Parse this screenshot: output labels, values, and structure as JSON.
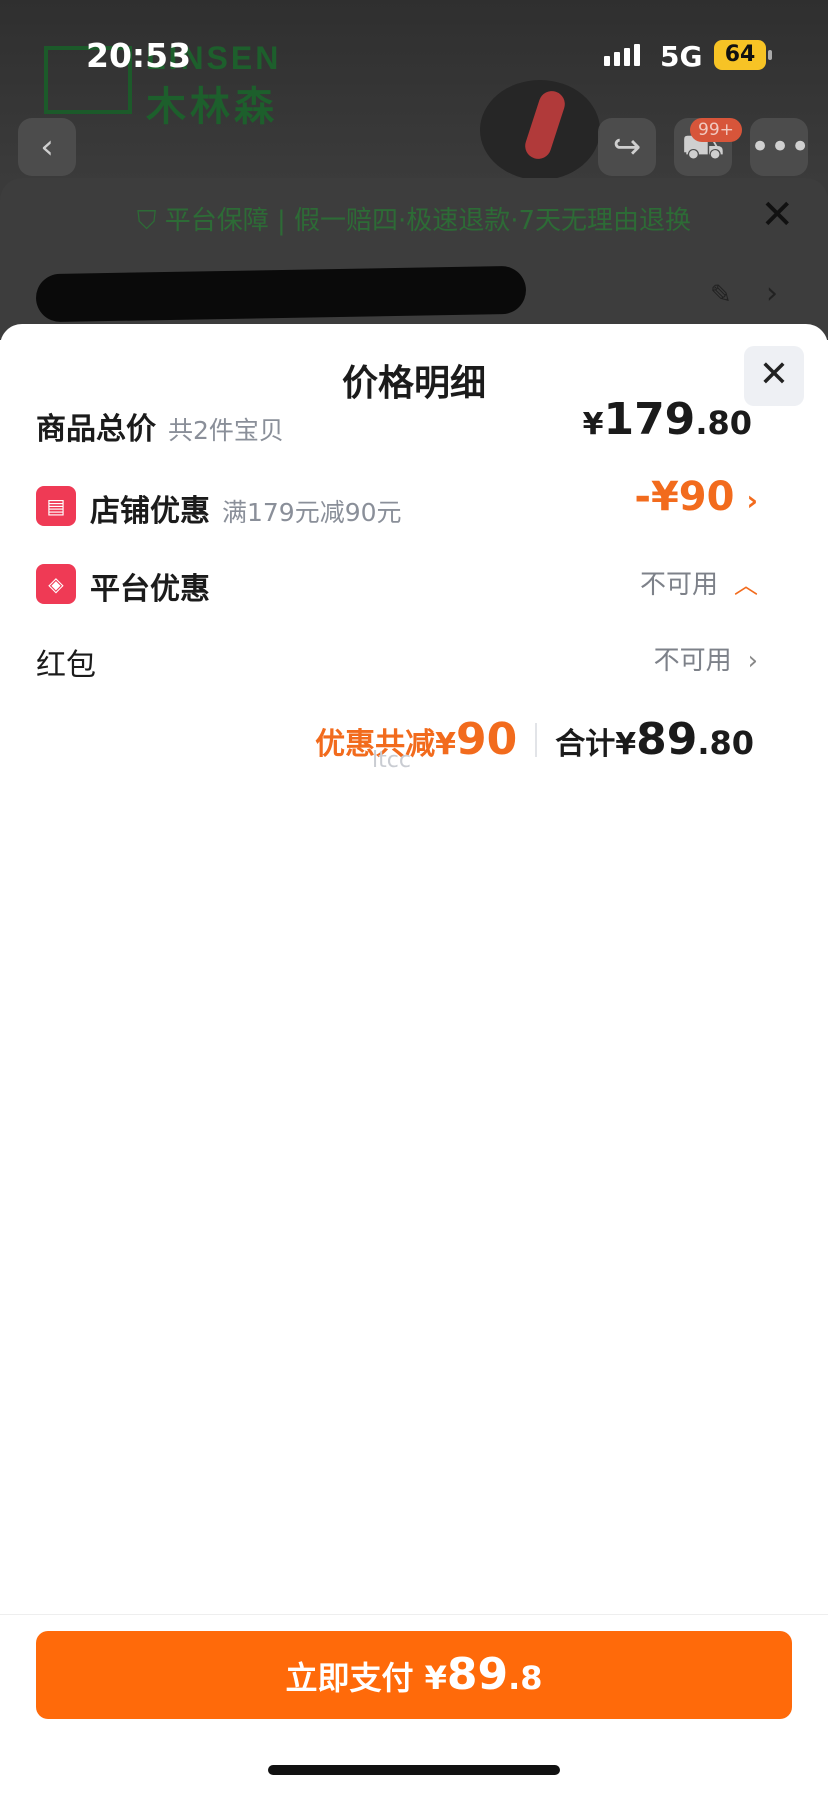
{
  "status_bar": {
    "time": "20:53",
    "network": "5G",
    "battery": "64"
  },
  "brand": {
    "name_en": "LINSEN",
    "name_cn": "木林森"
  },
  "cart_badge": "99+",
  "guarantee": {
    "text": "平台保障 | 假一赔四·极速退款·7天无理由退换"
  },
  "sheet": {
    "title": "价格明细",
    "rows": {
      "total": {
        "label": "商品总价",
        "sub": "共2件宝贝",
        "yen": "¥",
        "int": "179",
        "dec": ".80"
      },
      "shop": {
        "label": "店铺优惠",
        "sub": "满179元减90元",
        "value": "-¥90"
      },
      "platform": {
        "label": "平台优惠",
        "status": "不可用"
      },
      "red_packet": {
        "label": "红包",
        "status": "不可用"
      }
    },
    "summary": {
      "discount_prefix": "优惠共减¥",
      "discount_value": "90",
      "total_prefix": "合计¥",
      "total_int": "89",
      "total_dec": ".80"
    },
    "watermark": "ltcc"
  },
  "pay_button": {
    "prefix": "立即支付 ¥",
    "int": "89",
    "dec": ".8"
  },
  "colors": {
    "accent": "#ff6a0a",
    "orange_text": "#f26b1d",
    "icon_red": "#ef3a55"
  },
  "icons": [
    "back-icon",
    "share-icon",
    "cart-icon",
    "more-icon",
    "shield-icon",
    "close-icon",
    "edit-icon",
    "chevron-right-icon",
    "store-icon",
    "tag-icon",
    "chevron-up-icon"
  ]
}
